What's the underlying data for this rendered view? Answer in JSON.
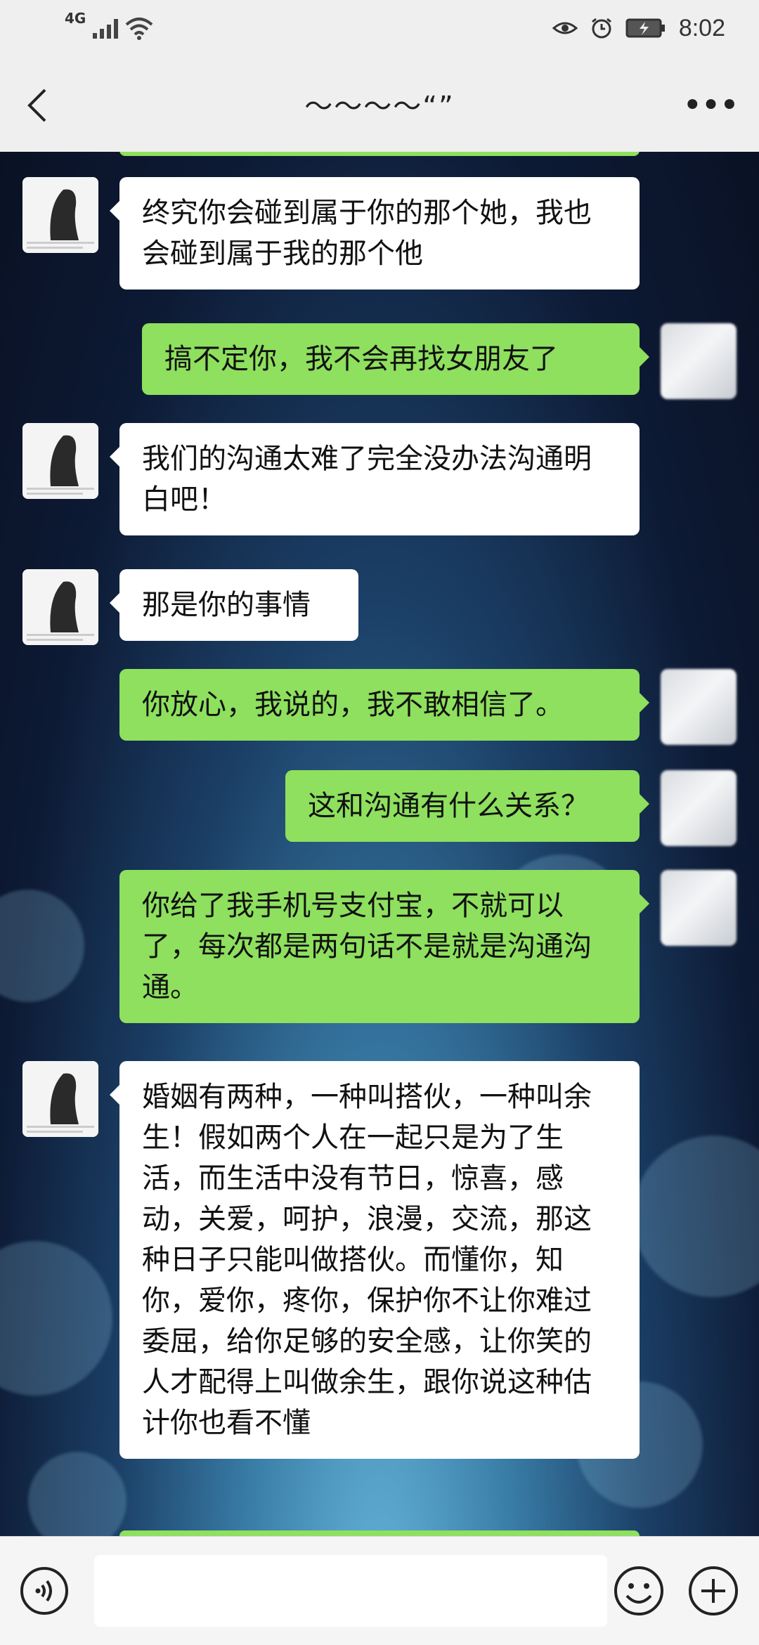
{
  "status_bar": {
    "network": "4G",
    "time": "8:02"
  },
  "header": {
    "title": "～～～～“”"
  },
  "messages": [
    {
      "side": "in",
      "text": "终究你会碰到属于你的那个她，我也会碰到属于我的那个他"
    },
    {
      "side": "out",
      "text": "搞不定你，我不会再找女朋友了"
    },
    {
      "side": "in",
      "text": "我们的沟通太难了完全没办法沟通明白吧！"
    },
    {
      "side": "in",
      "text": "那是你的事情"
    },
    {
      "side": "out",
      "text": "你放心，我说的，我不敢相信了。"
    },
    {
      "side": "out",
      "text": "这和沟通有什么关系？"
    },
    {
      "side": "out",
      "text": "你给了我手机号支付宝，不就可以了，每次都是两句话不是就是沟通沟通。"
    },
    {
      "side": "in",
      "text": "婚姻有两种，一种叫搭伙，一种叫余生！假如两个人在一起只是为了生活，而生活中没有节日，惊喜，感动，关爱，呵护，浪漫，交流，那这种日子只能叫做搭伙。而懂你，知你，爱你，疼你，保护你不让你难过委屈，给你足够的安全感，让你笑的人才配得上叫做余生，跟你说这种估计你也看不懂"
    }
  ],
  "icons": {
    "back": "chevron-left-icon",
    "more": "more-icon",
    "voice": "voice-icon",
    "emoji": "emoji-icon",
    "plus": "plus-icon",
    "eye": "eye-icon",
    "alarm": "alarm-icon",
    "battery": "battery-charging-icon",
    "wifi": "wifi-icon",
    "signal": "signal-icon"
  },
  "colors": {
    "bubble_out": "#8ee05e",
    "bubble_in": "#ffffff",
    "bar_bg": "#efefef"
  }
}
